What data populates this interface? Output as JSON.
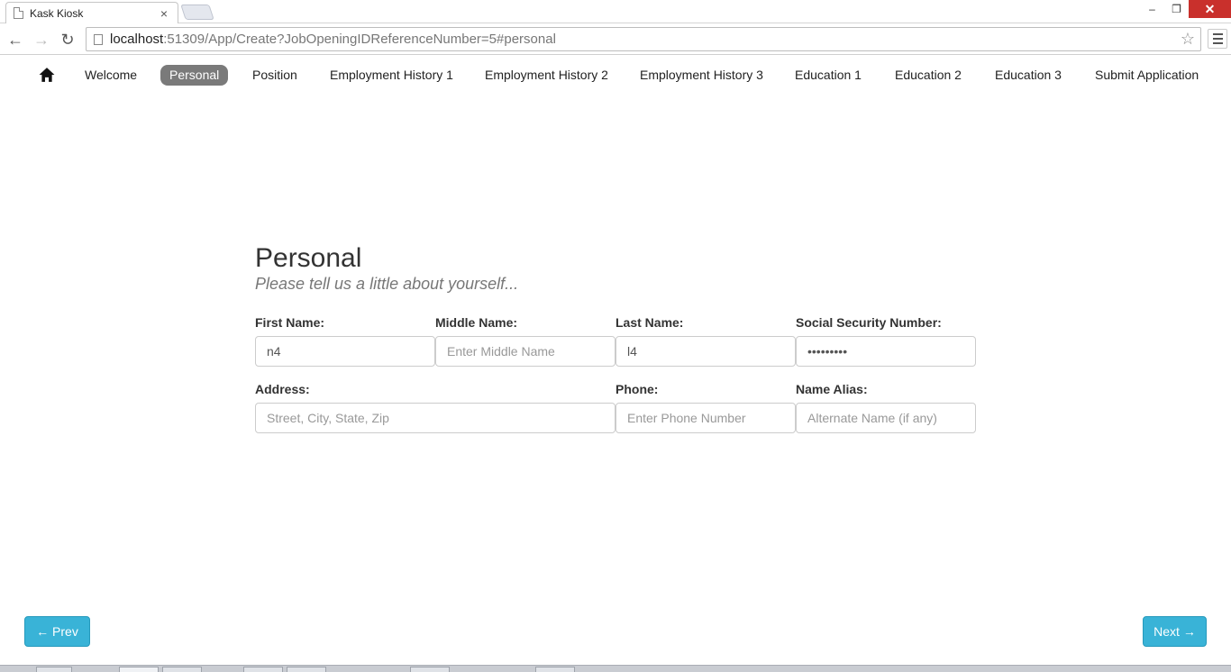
{
  "browser": {
    "tab_title": "Kask Kiosk",
    "tab_close": "×",
    "url_host": "localhost",
    "url_rest": ":51309/App/Create?JobOpeningIDReferenceNumber=5#personal",
    "win_minimize": "–",
    "win_restore": "❐",
    "win_close": "✕",
    "back": "←",
    "forward": "→",
    "reload": "↻",
    "star": "☆"
  },
  "nav": {
    "items": [
      {
        "label": "Welcome"
      },
      {
        "label": "Personal",
        "active": true
      },
      {
        "label": "Position"
      },
      {
        "label": "Employment History 1"
      },
      {
        "label": "Employment History 2"
      },
      {
        "label": "Employment History 3"
      },
      {
        "label": "Education 1"
      },
      {
        "label": "Education 2"
      },
      {
        "label": "Education 3"
      },
      {
        "label": "Submit Application"
      }
    ]
  },
  "form": {
    "title": "Personal",
    "subtitle": "Please tell us a little about yourself...",
    "first_name": {
      "label": "First Name:",
      "value": "n4",
      "placeholder": ""
    },
    "middle_name": {
      "label": "Middle Name:",
      "value": "",
      "placeholder": "Enter Middle Name"
    },
    "last_name": {
      "label": "Last Name:",
      "value": "l4",
      "placeholder": ""
    },
    "ssn": {
      "label": "Social Security Number:",
      "value": "123456789",
      "placeholder": ""
    },
    "address": {
      "label": "Address:",
      "value": "",
      "placeholder": "Street, City, State, Zip"
    },
    "phone": {
      "label": "Phone:",
      "value": "",
      "placeholder": "Enter Phone Number"
    },
    "alias": {
      "label": "Name Alias:",
      "value": "",
      "placeholder": "Alternate Name (if any)"
    }
  },
  "pager": {
    "prev_label": "← Prev",
    "next_label": "Next →"
  },
  "colors": {
    "accent": "#39b3d7",
    "active_tab": "#7a7a7a"
  }
}
